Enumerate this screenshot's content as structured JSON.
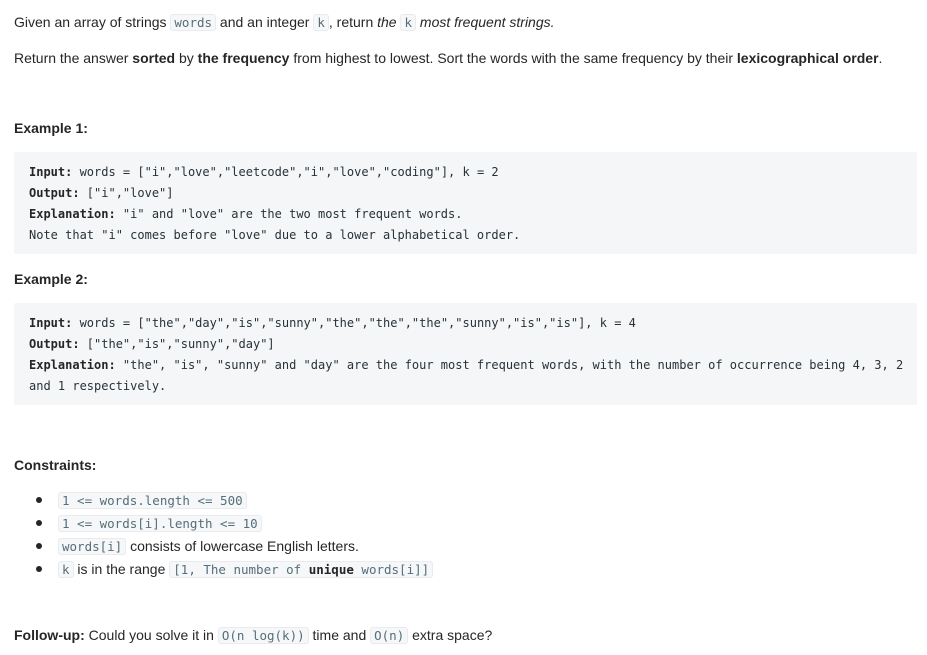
{
  "problem": {
    "p1": {
      "a": "Given an array of strings ",
      "code1": "words",
      "b": " and an integer ",
      "code2": "k",
      "c": ", return ",
      "d": "the",
      "code3": "k",
      "e": "most frequent strings."
    },
    "p2": {
      "a": "Return the answer ",
      "b": "sorted",
      "c": " by ",
      "d": "the frequency",
      "e": " from highest to lowest. Sort the words with the same frequency by their ",
      "f": "lexicographical order",
      "g": "."
    }
  },
  "examples": [
    {
      "heading": "Example 1:",
      "input_label": "Input:",
      "input": " words = [\"i\",\"love\",\"leetcode\",\"i\",\"love\",\"coding\"], k = 2",
      "output_label": "Output:",
      "output": " [\"i\",\"love\"]",
      "explanation_label": "Explanation:",
      "explanation_1": " \"i\" and \"love\" are the two most frequent words.",
      "explanation_2": "Note that \"i\" comes before \"love\" due to a lower alphabetical order."
    },
    {
      "heading": "Example 2:",
      "input_label": "Input:",
      "input": " words = [\"the\",\"day\",\"is\",\"sunny\",\"the\",\"the\",\"the\",\"sunny\",\"is\",\"is\"], k = 4",
      "output_label": "Output:",
      "output": " [\"the\",\"is\",\"sunny\",\"day\"]",
      "explanation_label": "Explanation:",
      "explanation_1": " \"the\", \"is\", \"sunny\" and \"day\" are the four most frequent words, with the number of occurrence being 4, 3, 2",
      "explanation_2": "and 1 respectively."
    }
  ],
  "constraints": {
    "heading": "Constraints:",
    "c1_code": "1 <= words.length <= 500",
    "c2_code": "1 <= words[i].length <= 10",
    "c3_code": "words[i]",
    "c3_text": " consists of lowercase English letters.",
    "c4_code": "k",
    "c4_text": " is in the range ",
    "c4_range_a": "[1, The number of ",
    "c4_range_b": "unique",
    "c4_range_c": " words[i]]"
  },
  "followup": {
    "label": "Follow-up:",
    "a": " Could you solve it in ",
    "code1": "O(n log(k))",
    "b": " time and ",
    "code2": "O(n)",
    "c": " extra space?"
  }
}
